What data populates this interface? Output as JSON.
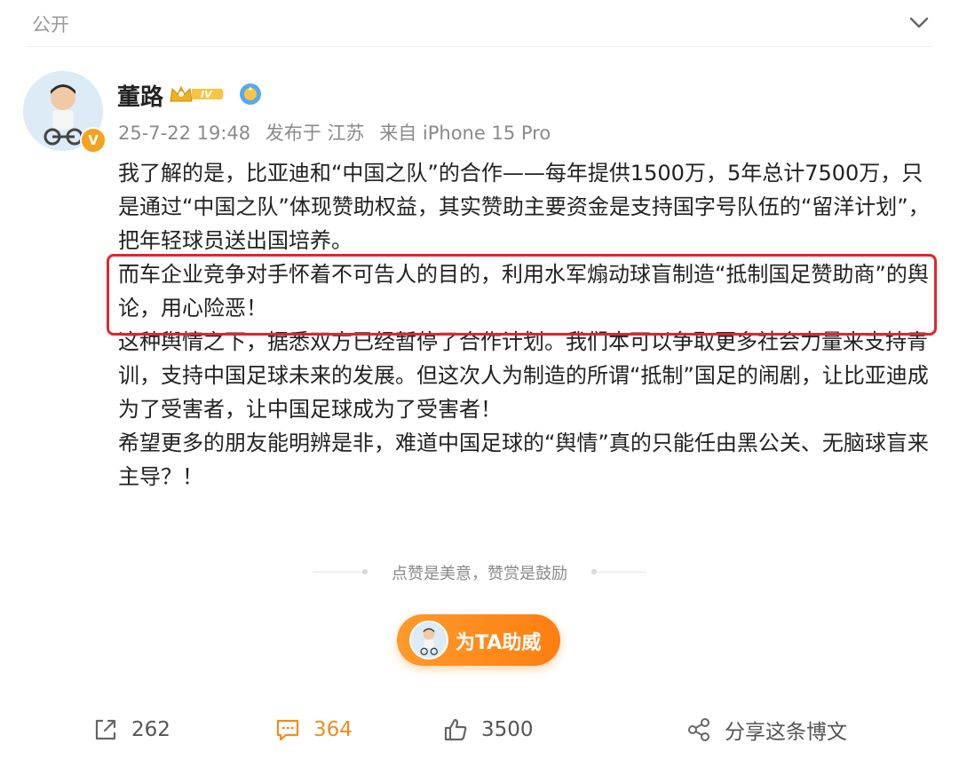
{
  "header": {
    "visibility": "公开",
    "collapse_icon": "chevron-down-icon"
  },
  "post": {
    "author": "董路",
    "badges": [
      "crown-level-badge",
      "sun-badge"
    ],
    "crown_level_text": "IV",
    "verified_badge": "V",
    "meta": {
      "date": "25-7-22 19:48",
      "location": "发布于 江苏",
      "source": "来自 iPhone 15 Pro"
    },
    "paragraphs": [
      "我了解的是，比亚迪和“中国之队”的合作——每年提供1500万，5年总计7500万，只是通过“中国之队”体现赞助权益，其实赞助主要资金是支持国字号队伍的“留洋计划”，把年轻球员送出国培养。",
      "而车企业竞争对手怀着不可告人的目的，利用水军煽动球盲制造“抵制国足赞助商”的舆论，用心险恶！",
      "这种舆情之下，据悉双方已经暂停了合作计划。我们本可以争取更多社会力量来支持青训，支持中国足球未来的发展。但这次人为制造的所谓“抵制”国足的闹剧，让比亚迪成为了受害者，让中国足球成为了受害者！",
      "希望更多的朋友能明辨是非，难道中国足球的“舆情”真的只能任由黑公关、无脑球盲来主导？！"
    ],
    "highlighted_paragraph_index": 1,
    "highlight_color": "#e0262e"
  },
  "reward": {
    "text": "点赞是美意，赞赏是鼓励",
    "button_label": "为TA助威",
    "button_color": "#ff8a1e"
  },
  "actions": {
    "repost": {
      "icon": "share-icon",
      "count": "262"
    },
    "comment": {
      "icon": "comment-icon",
      "count": "364",
      "active": true,
      "color": "#f08c1e"
    },
    "like": {
      "icon": "thumbs-up-icon",
      "count": "3500"
    },
    "share": {
      "icon": "link-share-icon",
      "label": "分享这条博文"
    }
  }
}
